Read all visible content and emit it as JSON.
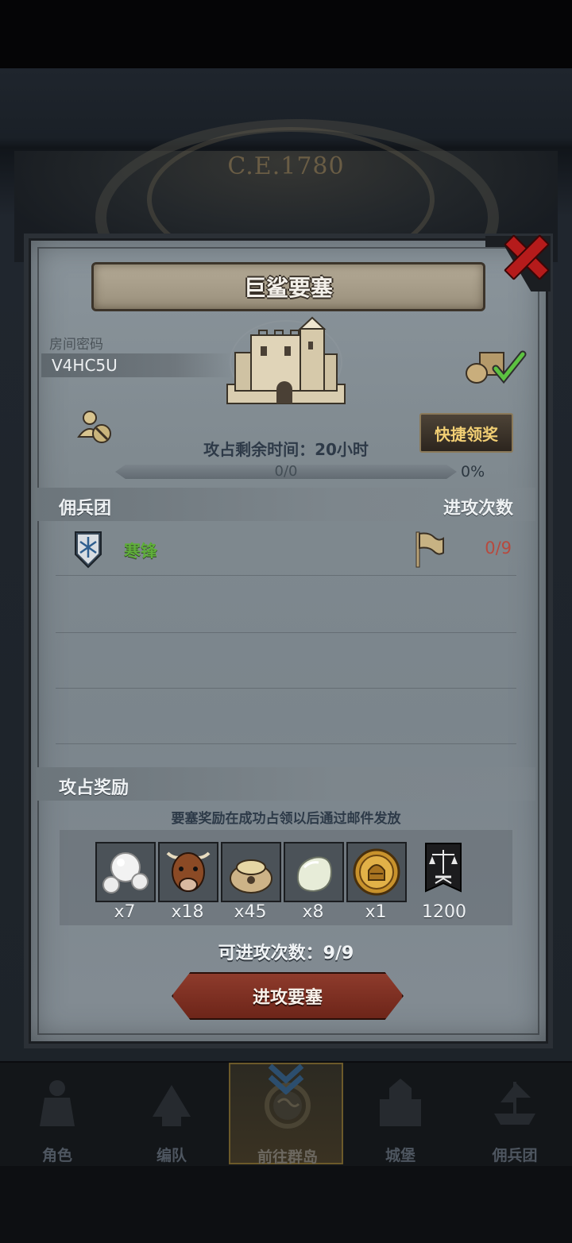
{
  "background": {
    "era": "C.E.1780"
  },
  "dialog": {
    "title": "巨鲨要塞",
    "room_label": "房间密码",
    "room_code": "V4HC5U",
    "quick_claim": "快捷领奖",
    "occupy_time": "攻占剩余时间：20小时",
    "progress_text": "0/0",
    "progress_percent": "0%",
    "progress_fraction": 0,
    "mercenary_header": "佣兵团",
    "attacks_header": "进攻次数",
    "mercenaries": [
      {
        "name": "寒锋",
        "attacks": "0/9"
      }
    ],
    "rewards_header": "攻占奖励",
    "rewards_note": "要塞奖励在成功占领以后通过邮件发放",
    "rewards": [
      {
        "icon": "pearls-icon",
        "qty": "x7"
      },
      {
        "icon": "cow-icon",
        "qty": "x18"
      },
      {
        "icon": "grain-sack-icon",
        "qty": "x45"
      },
      {
        "icon": "white-stone-icon",
        "qty": "x8"
      },
      {
        "icon": "gold-helmet-coin-icon",
        "qty": "x1"
      },
      {
        "icon": "justice-banner-icon",
        "qty": "1200"
      }
    ],
    "attack_count": "可进攻次数：9/9",
    "attack_button": "进攻要塞"
  },
  "nav": [
    {
      "label": "角色",
      "icon": "character-icon"
    },
    {
      "label": "编队",
      "icon": "formation-icon"
    },
    {
      "label": "前往群岛",
      "icon": "islands-globe-icon",
      "active": true
    },
    {
      "label": "城堡",
      "icon": "castle-icon"
    },
    {
      "label": "佣兵团",
      "icon": "ship-icon"
    }
  ],
  "colors": {
    "accent_gold": "#f2cf74",
    "merc_green": "#5fae3a",
    "count_red": "#b74a3e",
    "close_red": "#b51b1b"
  }
}
